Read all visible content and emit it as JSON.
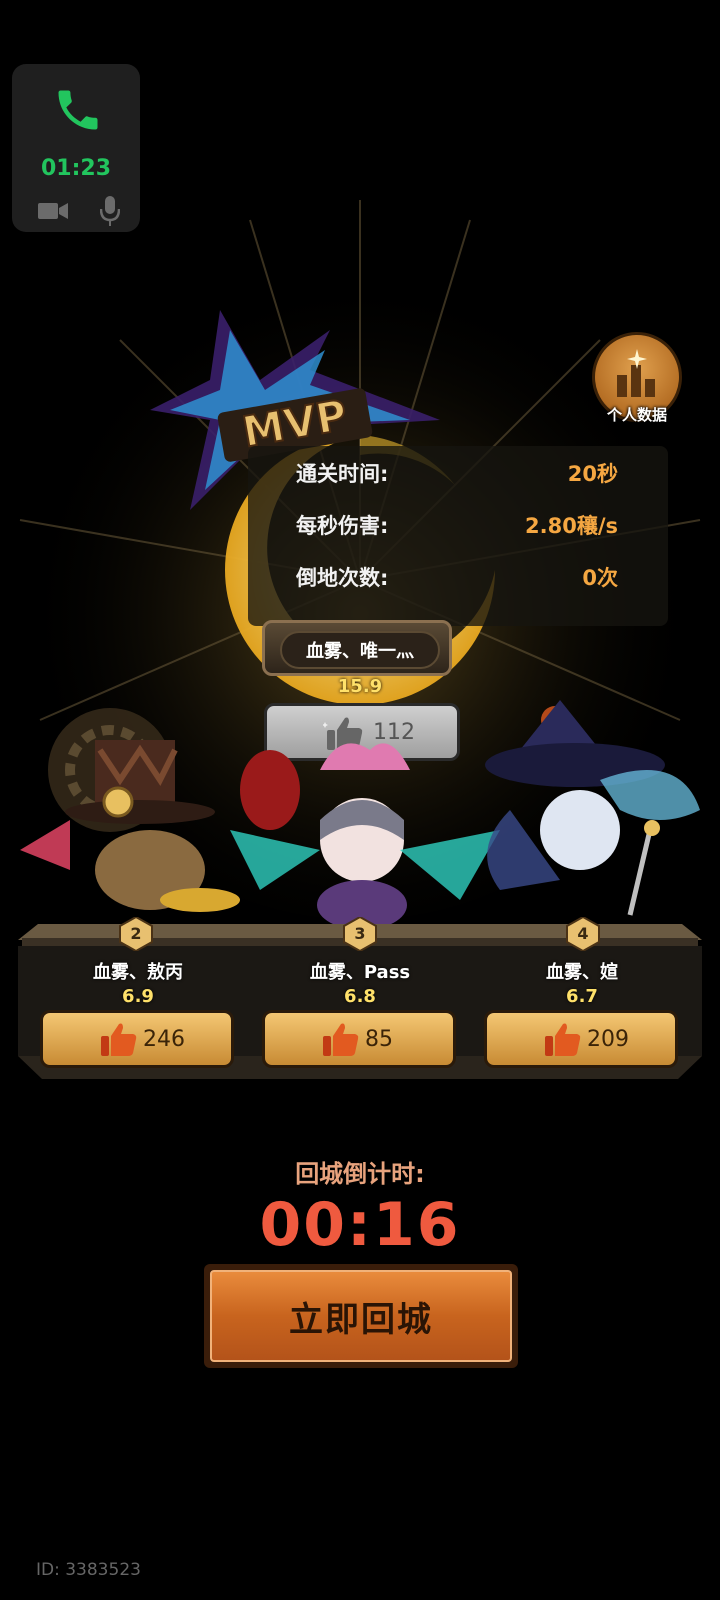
{
  "call": {
    "timer": "01:23"
  },
  "personal_data": {
    "label": "个人数据"
  },
  "mvp_badge": {
    "text": "MVP"
  },
  "stats": [
    {
      "key": "通关时间:",
      "value": "20秒"
    },
    {
      "key": "每秒伤害:",
      "value": "2.80穰/s"
    },
    {
      "key": "倒地次数:",
      "value": "0次"
    }
  ],
  "mvp_player": {
    "name": "血雾、唯一灬",
    "score": "15.9",
    "likes": "112"
  },
  "players": [
    {
      "rank": "2",
      "name": "血雾、敖丙",
      "score": "6.9",
      "likes": "246"
    },
    {
      "rank": "3",
      "name": "血雾、Pass",
      "score": "6.8",
      "likes": "85"
    },
    {
      "rank": "4",
      "name": "血雾、媗",
      "score": "6.7",
      "likes": "209"
    }
  ],
  "return": {
    "label": "回城倒计时:",
    "timer": "00:16",
    "button": "立即回城"
  },
  "footer": {
    "id": "ID: 3383523"
  },
  "colors": {
    "accent": "#f5a742",
    "timer_red": "#ef5a3f",
    "call_green": "#22c55e",
    "score_yellow": "#ffe16a"
  }
}
